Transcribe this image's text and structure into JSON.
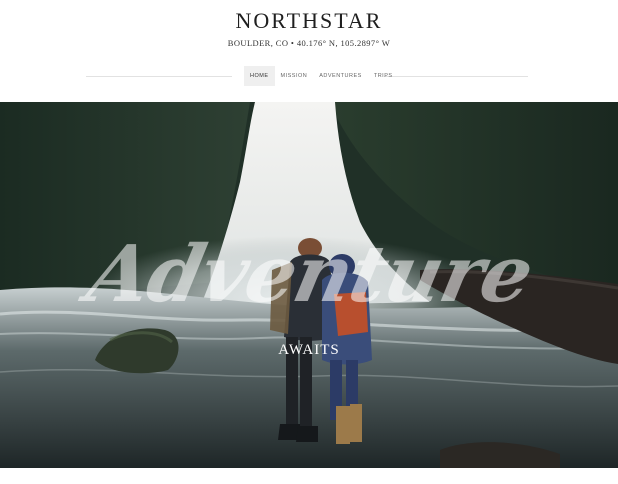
{
  "header": {
    "brand": "NORTHSTAR",
    "location": "BOULDER, CO • 40.176° N, 105.2897° W"
  },
  "nav": {
    "items": [
      {
        "label": "HOME",
        "active": true
      },
      {
        "label": "MISSION",
        "active": false
      },
      {
        "label": "ADVENTURES",
        "active": false
      },
      {
        "label": "TRIPS",
        "active": false
      }
    ]
  },
  "hero": {
    "headline": "Adventure",
    "subheadline": "AWAITS"
  }
}
